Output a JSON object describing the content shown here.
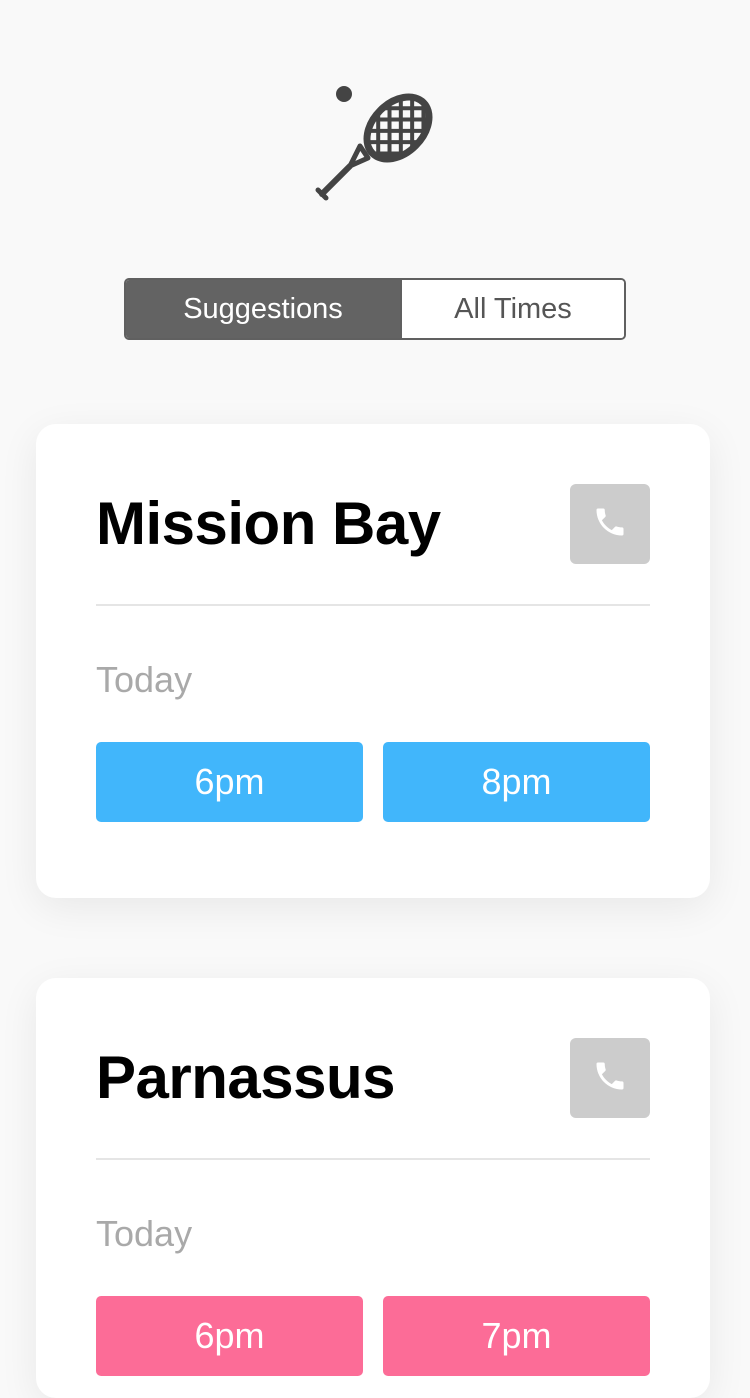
{
  "app": {
    "logo_icon": "tennis-racket-icon"
  },
  "segmented_control": {
    "items": [
      {
        "label": "Suggestions",
        "selected": true
      },
      {
        "label": "All Times",
        "selected": false
      }
    ]
  },
  "locations": [
    {
      "name": "Mission Bay",
      "phone_icon": "phone-icon",
      "day": "Today",
      "slot_color": "#41b6fb",
      "slots": [
        "6pm",
        "8pm"
      ]
    },
    {
      "name": "Parnassus",
      "phone_icon": "phone-icon",
      "day": "Today",
      "slot_color": "#fc6c97",
      "slots": [
        "6pm",
        "7pm"
      ]
    }
  ],
  "colors": {
    "background": "#f9f9f9",
    "segment_active": "#636363",
    "phone_button": "#cccccc",
    "day_label": "#a9a9a9"
  }
}
